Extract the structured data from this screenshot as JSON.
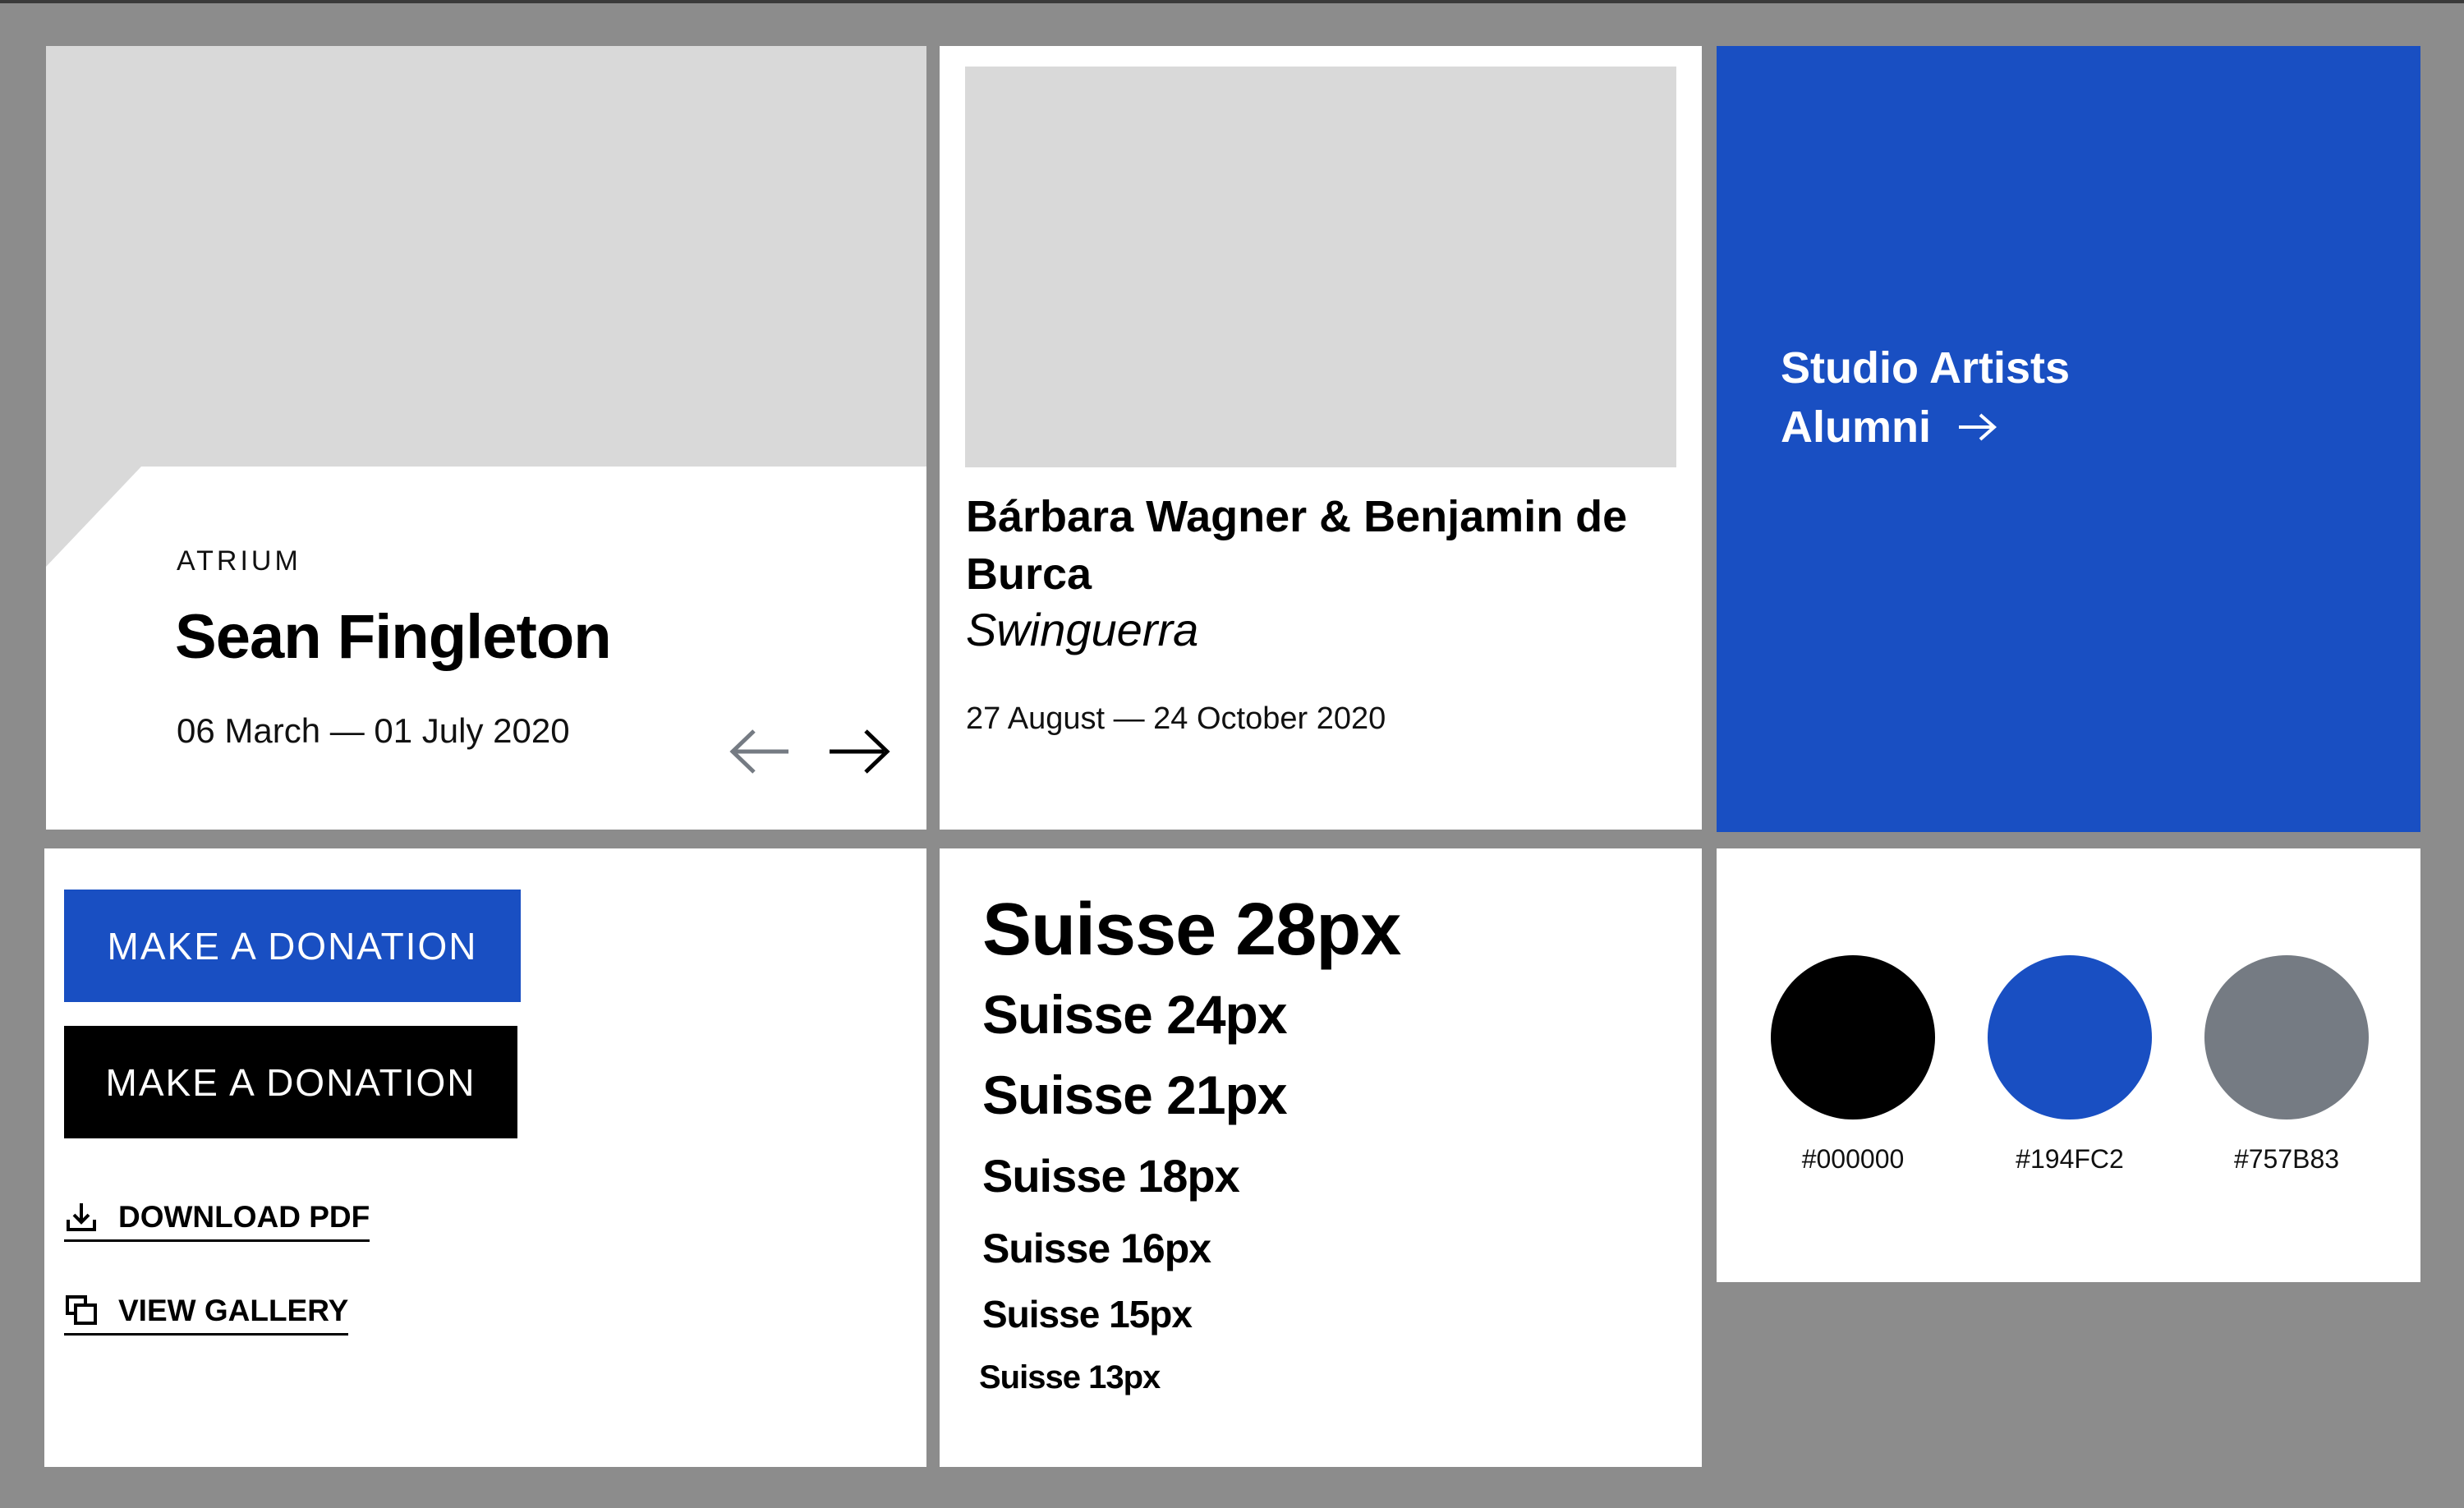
{
  "card1": {
    "eyebrow": "ATRIUM",
    "title": "Sean Fingleton",
    "dates": "06 March — 01 July 2020",
    "prev_icon": "arrow-left-icon",
    "next_icon": "arrow-right-icon"
  },
  "card2": {
    "artist": "Bárbara Wagner & Benjamin de Burca",
    "work": "Swinguerra",
    "dates": "27 August — 24 October 2020"
  },
  "card3": {
    "line1": "Studio Artists",
    "line2": "Alumni",
    "arrow_icon": "arrow-right-icon",
    "background": "#194FC2"
  },
  "buttons": {
    "primary_label": "MAKE A DONATION",
    "secondary_label": "MAKE A DONATION",
    "download_label": "DOWNLOAD PDF",
    "download_icon": "download-icon",
    "gallery_label": "VIEW GALLERY",
    "gallery_icon": "gallery-icon"
  },
  "type_scale": [
    {
      "label": "Suisse 28px"
    },
    {
      "label": "Suisse 24px"
    },
    {
      "label": "Suisse 21px"
    },
    {
      "label": "Suisse 18px"
    },
    {
      "label": "Suisse 16px"
    },
    {
      "label": "Suisse 15px"
    },
    {
      "label": "Suisse 13px"
    }
  ],
  "colors": [
    {
      "hex": "#000000",
      "label": "#000000"
    },
    {
      "hex": "#194FC2",
      "label": "#194FC2"
    },
    {
      "hex": "#757B83",
      "label": "#757B83"
    }
  ]
}
